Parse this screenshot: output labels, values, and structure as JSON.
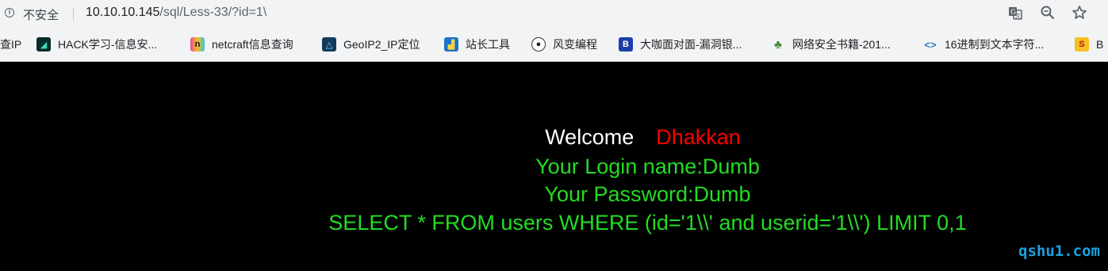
{
  "address_bar": {
    "security_label": "不安全",
    "url_host": "10.10.10.145",
    "url_path": "/sql/Less-33/?id=1\\"
  },
  "bookmarks": [
    {
      "label": "查IP",
      "icon": "none"
    },
    {
      "label": "HACK学习-信息安...",
      "icon": "hack-icon"
    },
    {
      "label": "netcraft信息查询",
      "icon": "netcraft-icon"
    },
    {
      "label": "GeoIP2_IP定位",
      "icon": "geoip-icon"
    },
    {
      "label": "站长工具",
      "icon": "chinaz-icon"
    },
    {
      "label": "风变编程",
      "icon": "panda-icon"
    },
    {
      "label": "大咖面对面-漏洞银...",
      "icon": "bugbank-icon"
    },
    {
      "label": "网络安全书籍-201...",
      "icon": "plant-icon"
    },
    {
      "label": "16进制到文本字符...",
      "icon": "code-icon"
    },
    {
      "label": "B",
      "icon": "s-icon"
    }
  ],
  "page": {
    "welcome": "Welcome",
    "username": "Dhakkan",
    "login_name": "Your Login name:Dumb",
    "password": "Your Password:Dumb",
    "query": "SELECT * FROM users WHERE (id='1\\\\' and userid='1\\\\') LIMIT 0,1",
    "watermark": "qshu1.com"
  },
  "colors": {
    "page_background": "#000000",
    "welcome_text": "#ffffff",
    "username_text": "#ff0000",
    "result_text": "#22dd22",
    "watermark": "#1e9fe0"
  }
}
